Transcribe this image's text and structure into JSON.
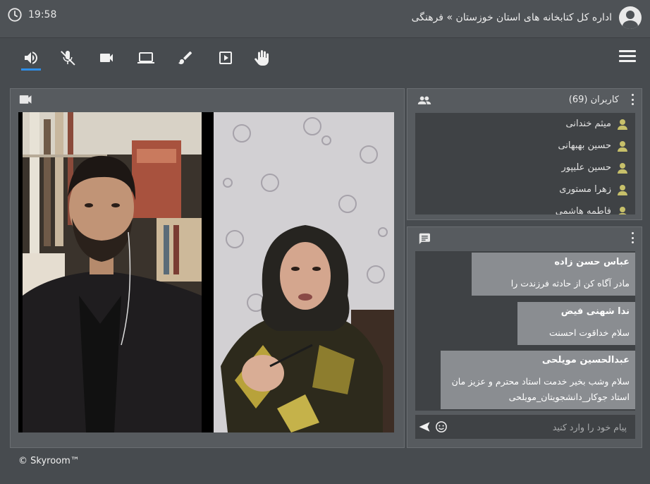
{
  "header": {
    "time": "19:58",
    "title": "اداره کل کتابخانه های استان خوزستان » فرهنگی",
    "clock_icon": "clock-icon",
    "avatar_icon": "account-circle-icon"
  },
  "toolbar": {
    "tools": [
      {
        "name": "speaker",
        "icon": "volume-icon",
        "active": true
      },
      {
        "name": "microphone",
        "icon": "mic-off-icon",
        "active": false
      },
      {
        "name": "camera",
        "icon": "videocam-icon",
        "active": false
      },
      {
        "name": "screen-share",
        "icon": "laptop-icon",
        "active": false
      },
      {
        "name": "whiteboard",
        "icon": "brush-icon",
        "active": false
      },
      {
        "name": "media",
        "icon": "play-box-icon",
        "active": false
      },
      {
        "name": "raise-hand",
        "icon": "hand-icon",
        "active": false
      }
    ],
    "menu_icon": "hamburger-menu-icon",
    "accent": "#2f8ee8"
  },
  "users": {
    "title": "کاربران (69)",
    "list": [
      "میثم خندانی",
      "حسین بهبهانی",
      "حسین علیپور",
      "زهرا مستوری",
      "فاطمه هاشمی"
    ],
    "icon_color": "#c7c06a"
  },
  "chat": {
    "messages": [
      {
        "author": "عباس حسن زاده",
        "text": "مادر آگاه کن از حادثه فرزندت را"
      },
      {
        "author": "ندا شهنی فیض",
        "text": "سلام خداقوت احسنت"
      },
      {
        "author": "عبدالحسین مویلحی",
        "text": "سلام وشب بخیر خدمت استاد محترم و عزیز مان استاد جوکار_دانشجویتان_مویلحی"
      }
    ],
    "placeholder": "پیام خود را وارد کنید"
  },
  "footer": {
    "copyright": "© Skyroom™"
  }
}
